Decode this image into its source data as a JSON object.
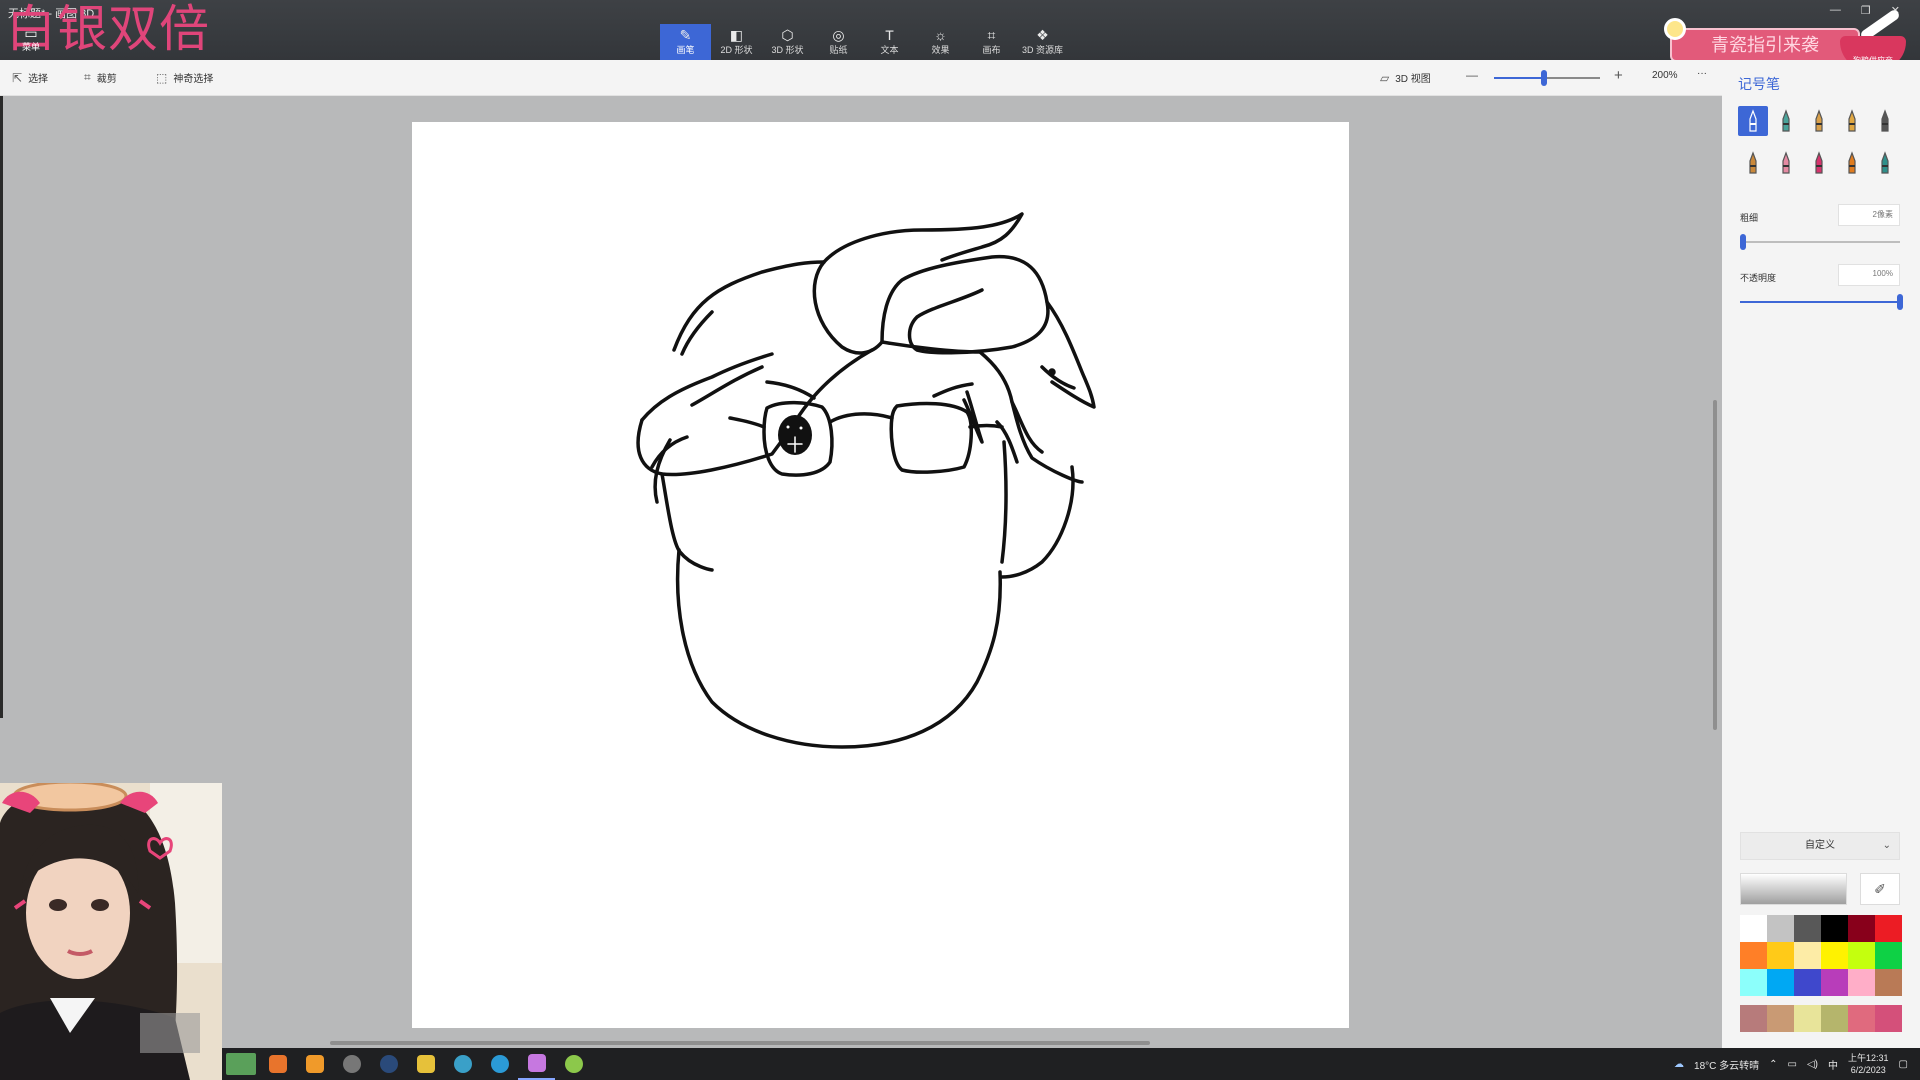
{
  "app": {
    "window_title": "无标题* - 画图 3D",
    "overlay_title": "白银双倍",
    "menu_label": "菜单"
  },
  "tool_tabs": [
    {
      "label": "画笔",
      "icon": "brush-icon",
      "active": true
    },
    {
      "label": "2D 形状",
      "icon": "2d-shape-icon",
      "active": false
    },
    {
      "label": "3D 形状",
      "icon": "3d-shape-icon",
      "active": false
    },
    {
      "label": "贴纸",
      "icon": "sticker-icon",
      "active": false
    },
    {
      "label": "文本",
      "icon": "text-icon",
      "active": false
    },
    {
      "label": "效果",
      "icon": "effects-icon",
      "active": false
    },
    {
      "label": "画布",
      "icon": "canvas-icon",
      "active": false
    },
    {
      "label": "3D 资源库",
      "icon": "3d-library-icon",
      "active": false
    }
  ],
  "badge": {
    "text": "青瓷指引来袭",
    "sub_text": "狗粮供应商"
  },
  "subbar": {
    "select_label": "选择",
    "crop_label": "裁剪",
    "magic_select_label": "神奇选择",
    "view3d_label": "3D 视图",
    "zoom_value": "200%",
    "zoom_fraction": 0.47,
    "more": "···"
  },
  "panel": {
    "title": "记号笔",
    "brushes": [
      {
        "name": "marker-brush",
        "color": "#3d67d6",
        "active": true
      },
      {
        "name": "calligraphy-pen-brush",
        "color": "#4aa39a",
        "active": false
      },
      {
        "name": "oil-brush",
        "color": "#d9a04a",
        "active": false
      },
      {
        "name": "watercolor-brush",
        "color": "#e0a742",
        "active": false
      },
      {
        "name": "pixel-pen-brush",
        "color": "#555555",
        "active": false
      },
      {
        "name": "pencil-brush",
        "color": "#c9883a",
        "active": false
      },
      {
        "name": "eraser-brush",
        "color": "#e48aa2",
        "active": false
      },
      {
        "name": "crayon-brush",
        "color": "#d6336c",
        "active": false
      },
      {
        "name": "spray-can-brush",
        "color": "#e07c1f",
        "active": false
      },
      {
        "name": "fill-bucket",
        "color": "#2f8f8a",
        "active": false
      }
    ],
    "thickness_label": "粗细",
    "thickness_value": "2像素",
    "thickness_fraction": 0.02,
    "opacity_label": "不透明度",
    "opacity_value": "100%",
    "opacity_fraction": 1.0,
    "color_mode": "自定义",
    "palette": [
      "#ffffff",
      "#c3c3c3",
      "#585858",
      "#000000",
      "#88001b",
      "#ec1c24",
      "#ff7f27",
      "#ffca18",
      "#fdeca6",
      "#fff200",
      "#c4ff0e",
      "#0ed145",
      "#8cfffb",
      "#00a8f3",
      "#3f48cc",
      "#b83dba",
      "#ffaec8",
      "#b97a56"
    ],
    "palette_custom": [
      "#b77b7b",
      "#c99a74",
      "#e8e49a",
      "#b5b56c",
      "#e06a7e",
      "#d4507a"
    ]
  },
  "taskbar": {
    "apps": [
      {
        "name": "wallpaper-app",
        "color": "#5aa05a"
      },
      {
        "name": "app-orange-1",
        "color": "#e8742c"
      },
      {
        "name": "app-orange-2",
        "color": "#f09a2a"
      },
      {
        "name": "clock-app",
        "color": "#777777"
      },
      {
        "name": "steam-app",
        "color": "#2a4a7a"
      },
      {
        "name": "game-app",
        "color": "#e6c13a"
      },
      {
        "name": "obs-app",
        "color": "#3aa0c8"
      },
      {
        "name": "edge-app",
        "color": "#2b9ad6"
      },
      {
        "name": "paint3d-app",
        "color": "#c678e0"
      },
      {
        "name": "green-app",
        "color": "#8cc84b"
      }
    ],
    "weather": "18°C 多云转晴",
    "ime": "中",
    "time": "上午12:31",
    "date": "6/2/2023"
  }
}
